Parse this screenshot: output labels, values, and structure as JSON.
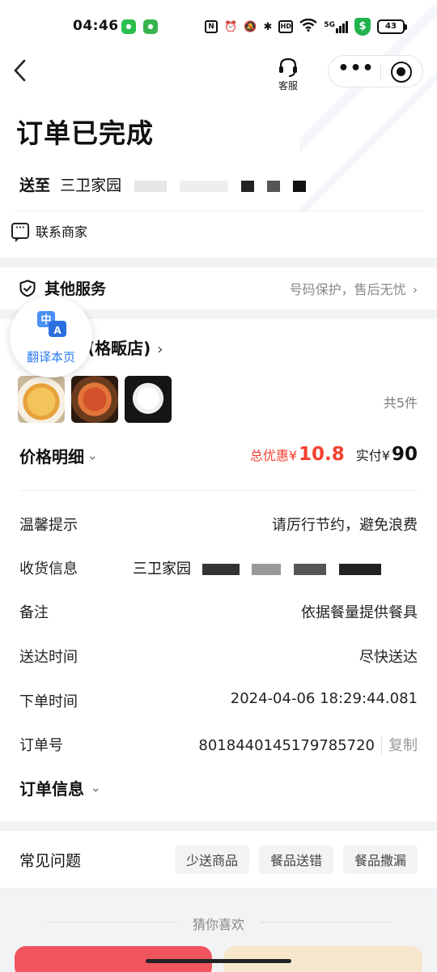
{
  "status_bar": {
    "time": "04:46",
    "nfc": "N",
    "battery": "43",
    "network": "5G"
  },
  "header": {
    "back_icon": "back-chevron-icon",
    "customer_service_label": "客服",
    "more_label": "•••"
  },
  "order": {
    "status_title": "订单已完成",
    "deliver_prefix": "送至",
    "deliver_address": "三卫家园"
  },
  "contact": {
    "label": "联系商家"
  },
  "services": {
    "label": "其他服务",
    "desc": "号码保护，售后无忧"
  },
  "shop": {
    "name": "(格畈店)",
    "item_count": "共5件"
  },
  "price": {
    "label": "价格明细",
    "discount_label": "总优惠",
    "discount_currency": "¥",
    "discount_value": "10.8",
    "paid_label": "实付",
    "paid_currency": "¥",
    "paid_value": "90"
  },
  "details": {
    "tip_label": "温馨提示",
    "tip_value": "请厉行节约，避免浪费",
    "receiver_label": "收货信息",
    "receiver_value": "三卫家园",
    "note_label": "备注",
    "note_value": "依据餐量提供餐具",
    "delivery_time_label": "送达时间",
    "delivery_time_value": "尽快送达",
    "order_time_label": "下单时间",
    "order_time_value": "2024-04-06 18:29:44.081",
    "order_no_label": "订单号",
    "order_no_value": "8018440145179785720",
    "copy_label": "复制",
    "order_info_label": "订单信息"
  },
  "faq": {
    "title": "常见问题",
    "tags": [
      "少送商品",
      "餐品送错",
      "餐品撒漏"
    ]
  },
  "guess": {
    "title": "猜你喜欢"
  },
  "translate": {
    "label": "翻译本页",
    "icon_cn": "中",
    "icon_en": "A"
  },
  "colors": {
    "discount_red": "#f43f2f",
    "translate_blue": "#2a7bf3",
    "background": "#f2f3f5"
  }
}
